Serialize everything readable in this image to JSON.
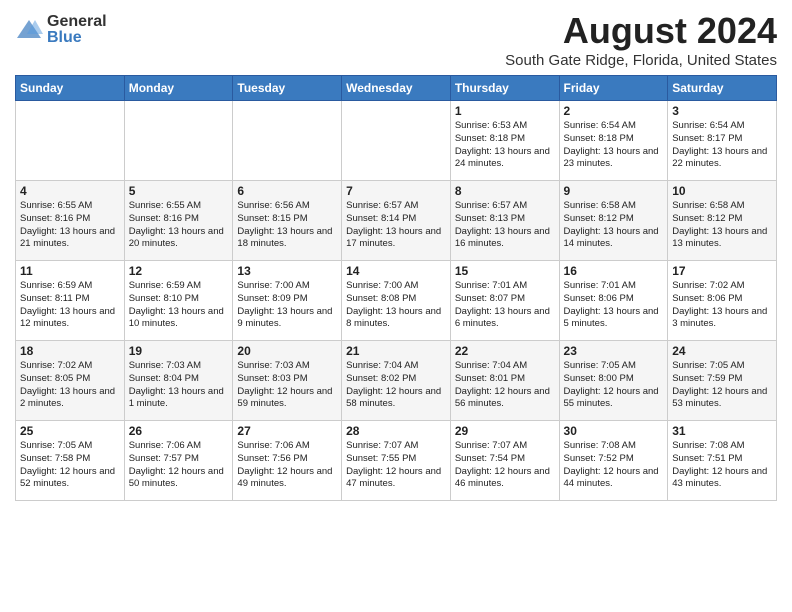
{
  "logo": {
    "general": "General",
    "blue": "Blue"
  },
  "title": "August 2024",
  "location": "South Gate Ridge, Florida, United States",
  "days_of_week": [
    "Sunday",
    "Monday",
    "Tuesday",
    "Wednesday",
    "Thursday",
    "Friday",
    "Saturday"
  ],
  "weeks": [
    [
      {
        "day": "",
        "info": ""
      },
      {
        "day": "",
        "info": ""
      },
      {
        "day": "",
        "info": ""
      },
      {
        "day": "",
        "info": ""
      },
      {
        "day": "1",
        "info": "Sunrise: 6:53 AM\nSunset: 8:18 PM\nDaylight: 13 hours and 24 minutes."
      },
      {
        "day": "2",
        "info": "Sunrise: 6:54 AM\nSunset: 8:18 PM\nDaylight: 13 hours and 23 minutes."
      },
      {
        "day": "3",
        "info": "Sunrise: 6:54 AM\nSunset: 8:17 PM\nDaylight: 13 hours and 22 minutes."
      }
    ],
    [
      {
        "day": "4",
        "info": "Sunrise: 6:55 AM\nSunset: 8:16 PM\nDaylight: 13 hours and 21 minutes."
      },
      {
        "day": "5",
        "info": "Sunrise: 6:55 AM\nSunset: 8:16 PM\nDaylight: 13 hours and 20 minutes."
      },
      {
        "day": "6",
        "info": "Sunrise: 6:56 AM\nSunset: 8:15 PM\nDaylight: 13 hours and 18 minutes."
      },
      {
        "day": "7",
        "info": "Sunrise: 6:57 AM\nSunset: 8:14 PM\nDaylight: 13 hours and 17 minutes."
      },
      {
        "day": "8",
        "info": "Sunrise: 6:57 AM\nSunset: 8:13 PM\nDaylight: 13 hours and 16 minutes."
      },
      {
        "day": "9",
        "info": "Sunrise: 6:58 AM\nSunset: 8:12 PM\nDaylight: 13 hours and 14 minutes."
      },
      {
        "day": "10",
        "info": "Sunrise: 6:58 AM\nSunset: 8:12 PM\nDaylight: 13 hours and 13 minutes."
      }
    ],
    [
      {
        "day": "11",
        "info": "Sunrise: 6:59 AM\nSunset: 8:11 PM\nDaylight: 13 hours and 12 minutes."
      },
      {
        "day": "12",
        "info": "Sunrise: 6:59 AM\nSunset: 8:10 PM\nDaylight: 13 hours and 10 minutes."
      },
      {
        "day": "13",
        "info": "Sunrise: 7:00 AM\nSunset: 8:09 PM\nDaylight: 13 hours and 9 minutes."
      },
      {
        "day": "14",
        "info": "Sunrise: 7:00 AM\nSunset: 8:08 PM\nDaylight: 13 hours and 8 minutes."
      },
      {
        "day": "15",
        "info": "Sunrise: 7:01 AM\nSunset: 8:07 PM\nDaylight: 13 hours and 6 minutes."
      },
      {
        "day": "16",
        "info": "Sunrise: 7:01 AM\nSunset: 8:06 PM\nDaylight: 13 hours and 5 minutes."
      },
      {
        "day": "17",
        "info": "Sunrise: 7:02 AM\nSunset: 8:06 PM\nDaylight: 13 hours and 3 minutes."
      }
    ],
    [
      {
        "day": "18",
        "info": "Sunrise: 7:02 AM\nSunset: 8:05 PM\nDaylight: 13 hours and 2 minutes."
      },
      {
        "day": "19",
        "info": "Sunrise: 7:03 AM\nSunset: 8:04 PM\nDaylight: 13 hours and 1 minute."
      },
      {
        "day": "20",
        "info": "Sunrise: 7:03 AM\nSunset: 8:03 PM\nDaylight: 12 hours and 59 minutes."
      },
      {
        "day": "21",
        "info": "Sunrise: 7:04 AM\nSunset: 8:02 PM\nDaylight: 12 hours and 58 minutes."
      },
      {
        "day": "22",
        "info": "Sunrise: 7:04 AM\nSunset: 8:01 PM\nDaylight: 12 hours and 56 minutes."
      },
      {
        "day": "23",
        "info": "Sunrise: 7:05 AM\nSunset: 8:00 PM\nDaylight: 12 hours and 55 minutes."
      },
      {
        "day": "24",
        "info": "Sunrise: 7:05 AM\nSunset: 7:59 PM\nDaylight: 12 hours and 53 minutes."
      }
    ],
    [
      {
        "day": "25",
        "info": "Sunrise: 7:05 AM\nSunset: 7:58 PM\nDaylight: 12 hours and 52 minutes."
      },
      {
        "day": "26",
        "info": "Sunrise: 7:06 AM\nSunset: 7:57 PM\nDaylight: 12 hours and 50 minutes."
      },
      {
        "day": "27",
        "info": "Sunrise: 7:06 AM\nSunset: 7:56 PM\nDaylight: 12 hours and 49 minutes."
      },
      {
        "day": "28",
        "info": "Sunrise: 7:07 AM\nSunset: 7:55 PM\nDaylight: 12 hours and 47 minutes."
      },
      {
        "day": "29",
        "info": "Sunrise: 7:07 AM\nSunset: 7:54 PM\nDaylight: 12 hours and 46 minutes."
      },
      {
        "day": "30",
        "info": "Sunrise: 7:08 AM\nSunset: 7:52 PM\nDaylight: 12 hours and 44 minutes."
      },
      {
        "day": "31",
        "info": "Sunrise: 7:08 AM\nSunset: 7:51 PM\nDaylight: 12 hours and 43 minutes."
      }
    ]
  ]
}
